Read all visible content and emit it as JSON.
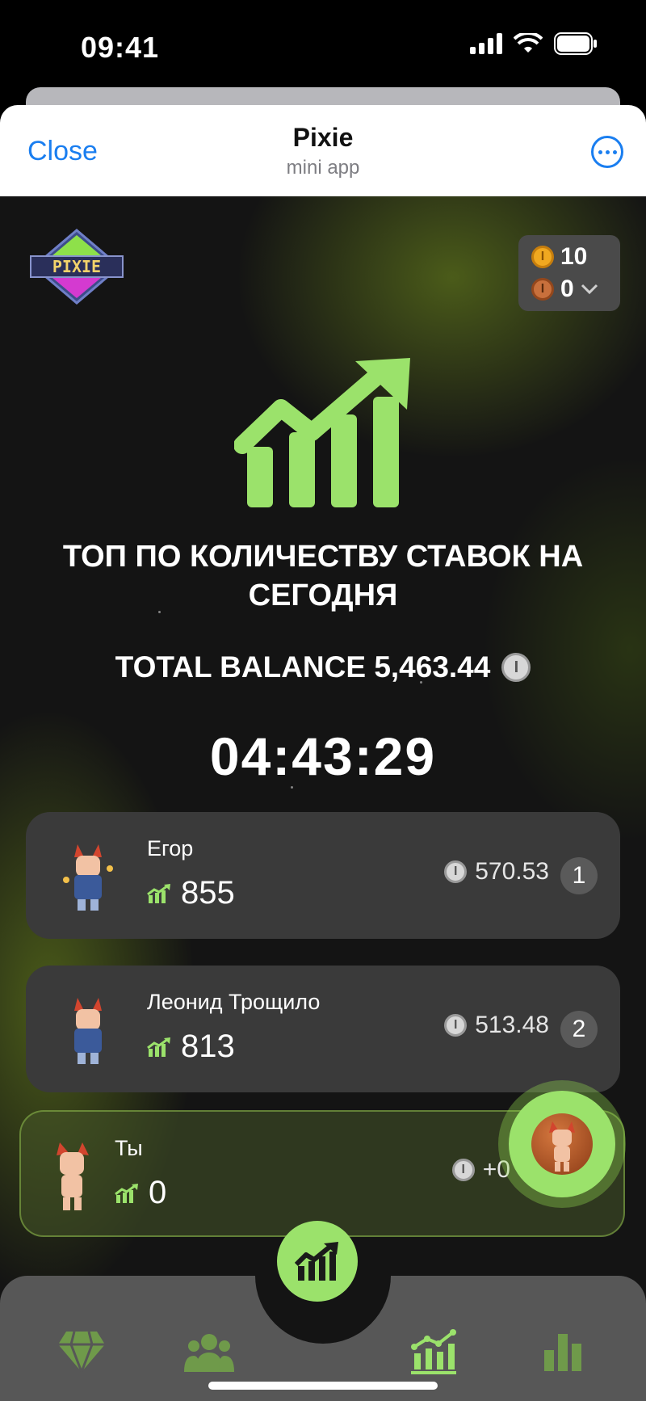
{
  "status_bar": {
    "time": "09:41"
  },
  "header": {
    "close_label": "Close",
    "title": "Pixie",
    "subtitle": "mini app"
  },
  "logo": {
    "text": "PIXIE"
  },
  "balances": {
    "gold": "10",
    "bronze": "0"
  },
  "main": {
    "title": "ТОП ПО КОЛИЧЕСТВУ СТАВОК НА СЕГОДНЯ",
    "total_balance_label": "TOTAL BALANCE 5,463.44",
    "timer": "04:43:29"
  },
  "leaderboard": [
    {
      "name": "Егор",
      "score": "855",
      "amount": "570.53",
      "rank": "1"
    },
    {
      "name": "Леонид Трощило",
      "score": "813",
      "amount": "513.48",
      "rank": "2"
    }
  ],
  "me": {
    "name": "Ты",
    "score": "0",
    "amount": "+0"
  },
  "tabs": [
    "gem-icon",
    "users-icon",
    "trend-chart-icon",
    "bar-chart-icon"
  ],
  "colors": {
    "accent": "#9be26b",
    "link": "#1a7ef0"
  }
}
